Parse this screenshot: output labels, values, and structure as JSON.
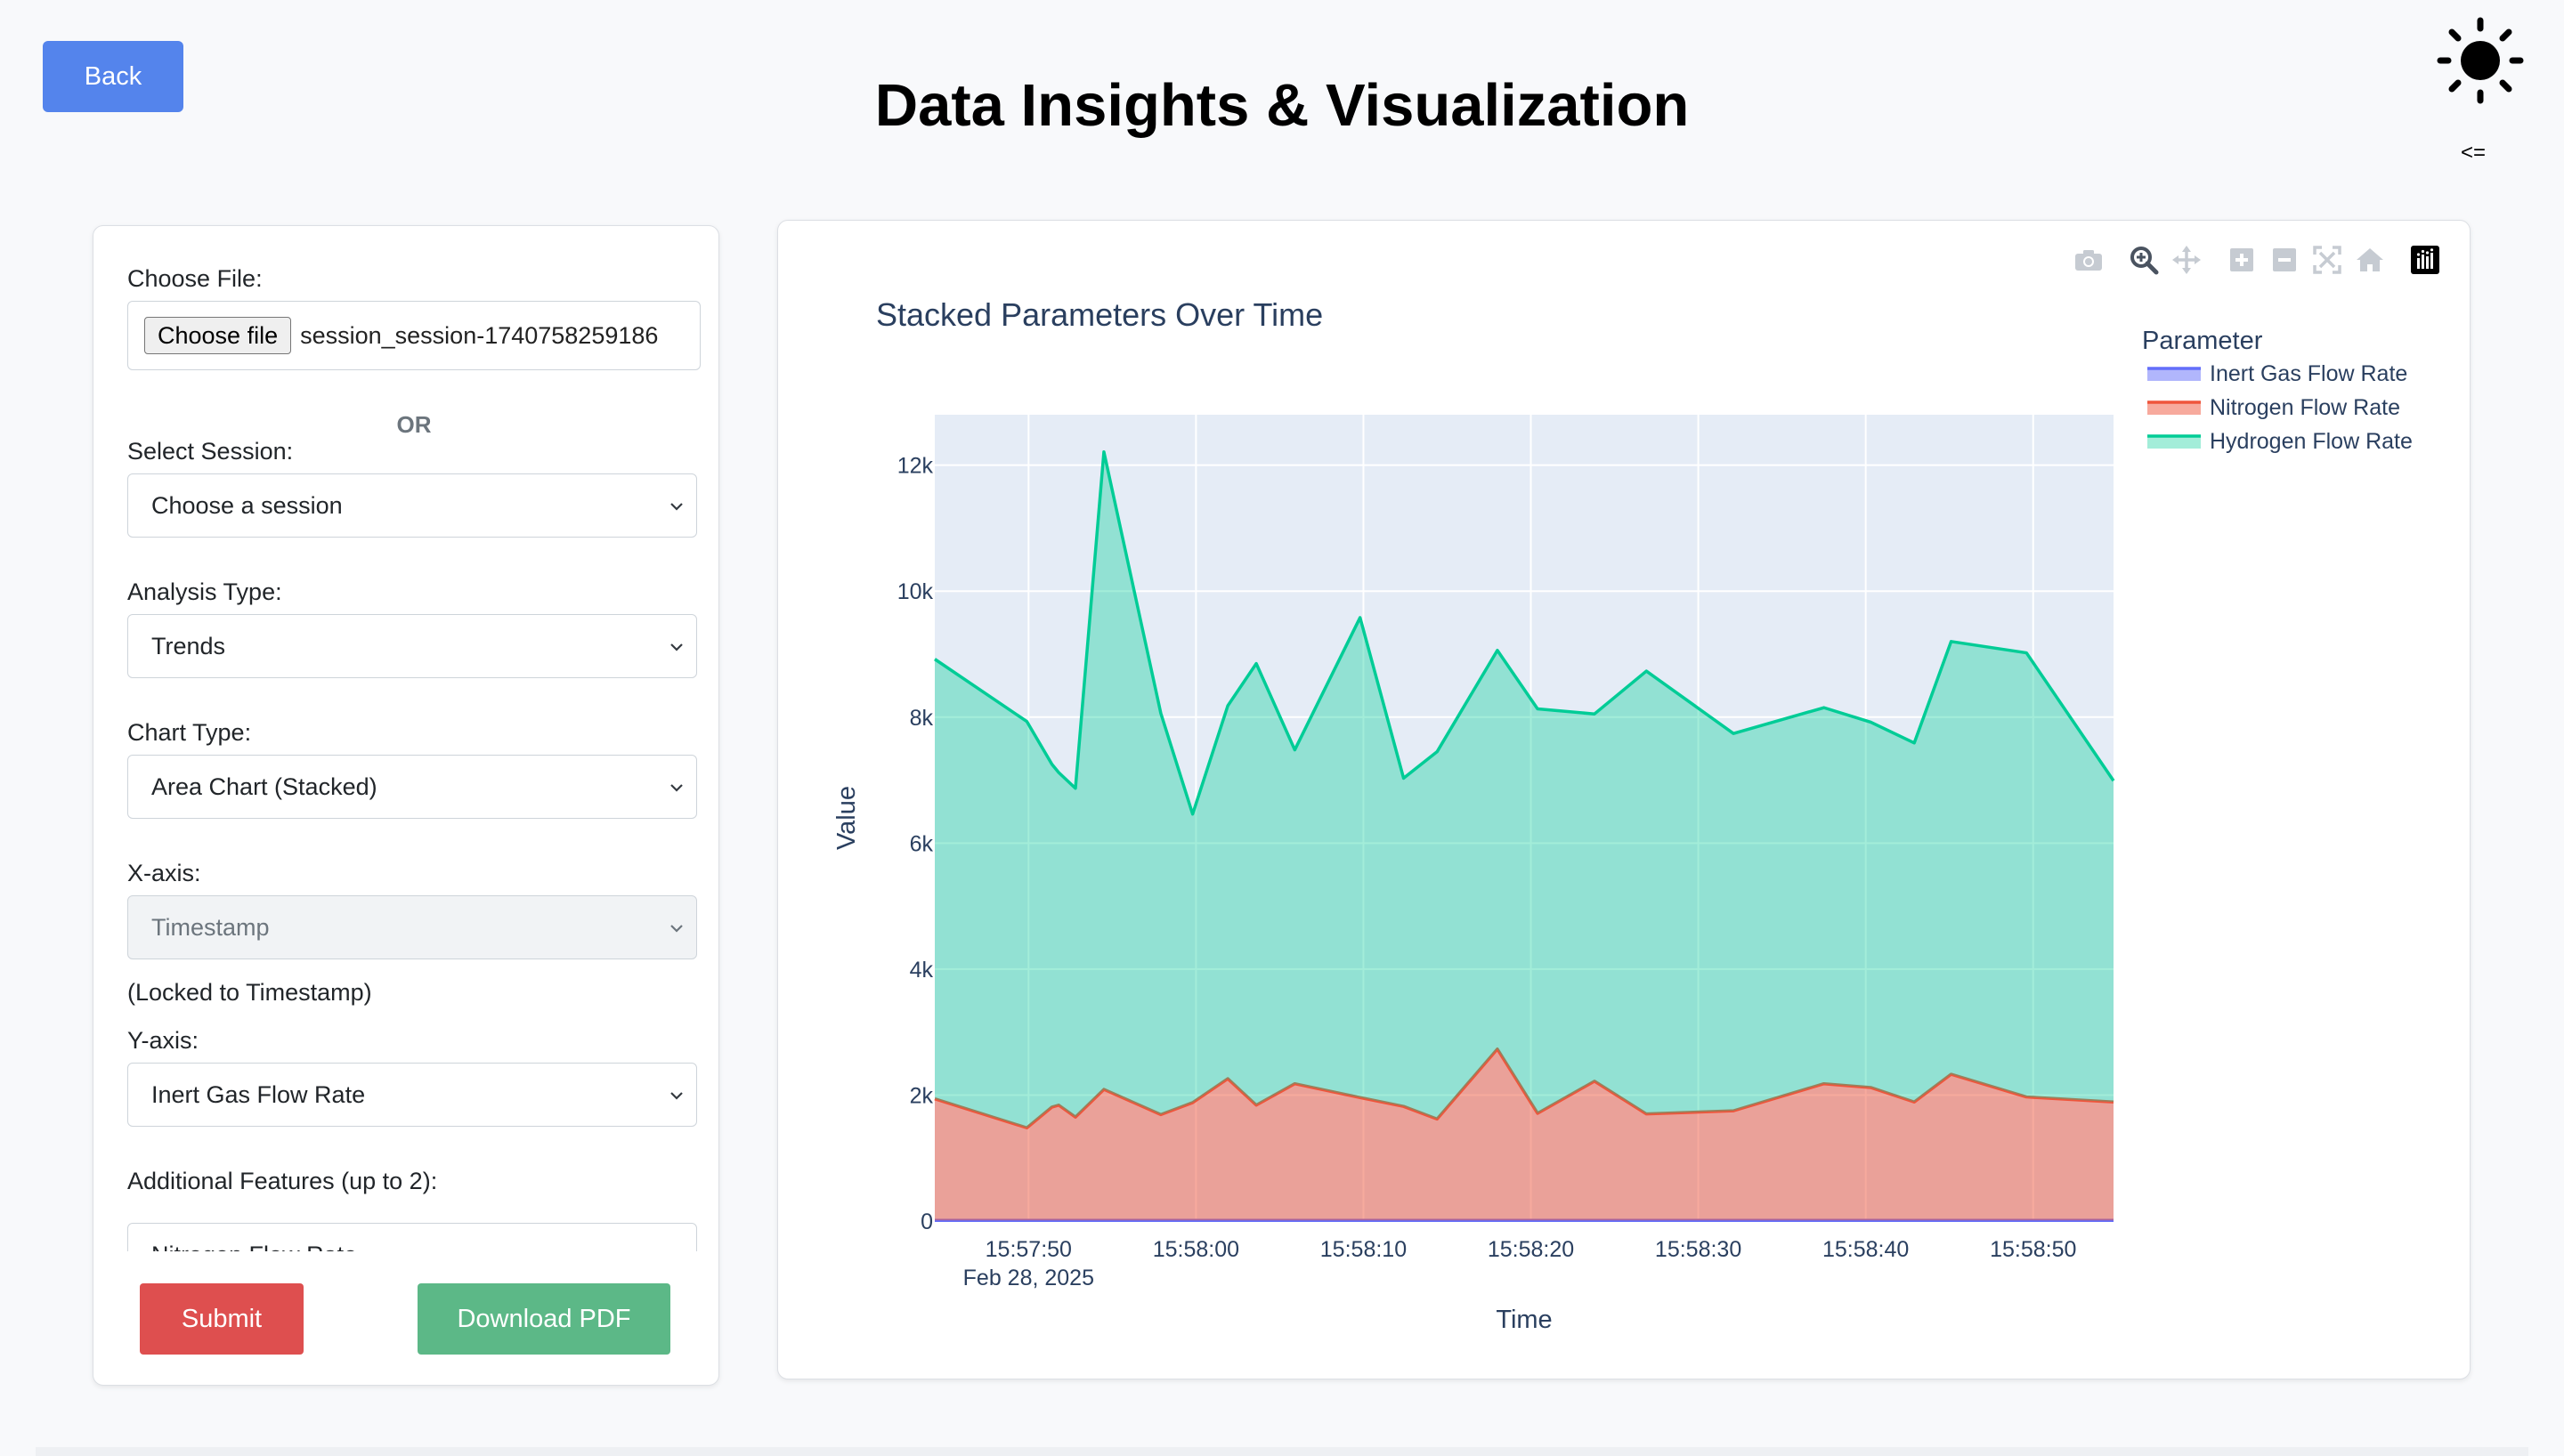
{
  "header": {
    "back_label": "Back",
    "title": "Data Insights & Visualization",
    "theme_icon": "sun-icon",
    "collapse_label": "<="
  },
  "sidebar": {
    "file_label": "Choose File:",
    "file_button": "Choose file",
    "file_name": "session_session-1740758259186",
    "or_label": "OR",
    "session_label": "Select Session:",
    "session_value": "Choose a session",
    "analysis_label": "Analysis Type:",
    "analysis_value": "Trends",
    "chart_type_label": "Chart Type:",
    "chart_type_value": "Area Chart (Stacked)",
    "xaxis_label": "X-axis:",
    "xaxis_value": "Timestamp",
    "xaxis_note": "(Locked to Timestamp)",
    "yaxis_label": "Y-axis:",
    "yaxis_value": "Inert Gas Flow Rate",
    "additional_label": "Additional Features (up to 2):",
    "additional_value": "Nitrogen Flow Rate",
    "submit_label": "Submit",
    "pdf_label": "Download PDF"
  },
  "modebar": {
    "icons": [
      "camera-icon",
      "zoom-icon",
      "pan-icon",
      "zoom-in-icon",
      "zoom-out-icon",
      "autoscale-icon",
      "reset-axes-icon",
      "plotly-logo-icon"
    ]
  },
  "chart_data": {
    "type": "area",
    "stacked": true,
    "title": "Stacked Parameters Over Time",
    "xlabel": "Time",
    "ylabel": "Value",
    "legend_title": "Parameter",
    "legend_position": "right",
    "grid": true,
    "x_ticks": [
      "15:57:50",
      "15:58:00",
      "15:58:10",
      "15:58:20",
      "15:58:30",
      "15:58:40",
      "15:58:50"
    ],
    "x_tick_sub": "Feb 28, 2025",
    "x_range": [
      "15:57:44.4",
      "15:58:54.8"
    ],
    "y_ticks": [
      "0",
      "2k",
      "4k",
      "6k",
      "8k",
      "10k",
      "12k"
    ],
    "y_tick_values": [
      0,
      2000,
      4000,
      6000,
      8000,
      10000,
      12000
    ],
    "ylim": [
      0,
      12800
    ],
    "x": [
      "15:57:44.4",
      "15:57:49.9",
      "15:57:51.4",
      "15:57:51.8",
      "15:57:52.8",
      "15:57:54.5",
      "15:57:57.9",
      "15:57:59.8",
      "15:58:01.9",
      "15:58:03.6",
      "15:58:05.9",
      "15:58:09.8",
      "15:58:12.4",
      "15:58:14.4",
      "15:58:18.0",
      "15:58:20.4",
      "15:58:23.8",
      "15:58:26.9",
      "15:58:32.1",
      "15:58:37.5",
      "15:58:40.3",
      "15:58:42.9",
      "15:58:45.1",
      "15:58:49.6",
      "15:58:54.8"
    ],
    "series": [
      {
        "name": "Inert Gas Flow Rate",
        "color": "#636efa",
        "values": [
          10,
          10,
          10,
          10,
          10,
          10,
          10,
          10,
          10,
          10,
          10,
          10,
          10,
          10,
          10,
          10,
          10,
          10,
          10,
          10,
          10,
          10,
          10,
          10,
          10
        ]
      },
      {
        "name": "Nitrogen Flow Rate",
        "color": "#ef553b",
        "values": [
          1930,
          1470,
          1800,
          1830,
          1640,
          2080,
          1680,
          1870,
          2250,
          1830,
          2170,
          1950,
          1810,
          1610,
          2720,
          1700,
          2210,
          1690,
          1740,
          2170,
          2110,
          1880,
          2320,
          1960,
          1880
        ]
      },
      {
        "name": "Hydrogen Flow Rate",
        "color": "#00cc96",
        "values": [
          6980,
          6450,
          5440,
          5280,
          5220,
          10120,
          6370,
          4580,
          5920,
          7010,
          5300,
          7620,
          5210,
          5830,
          6330,
          6420,
          5830,
          7030,
          5990,
          5970,
          5800,
          5700,
          6870,
          7050,
          5100
        ]
      }
    ]
  }
}
